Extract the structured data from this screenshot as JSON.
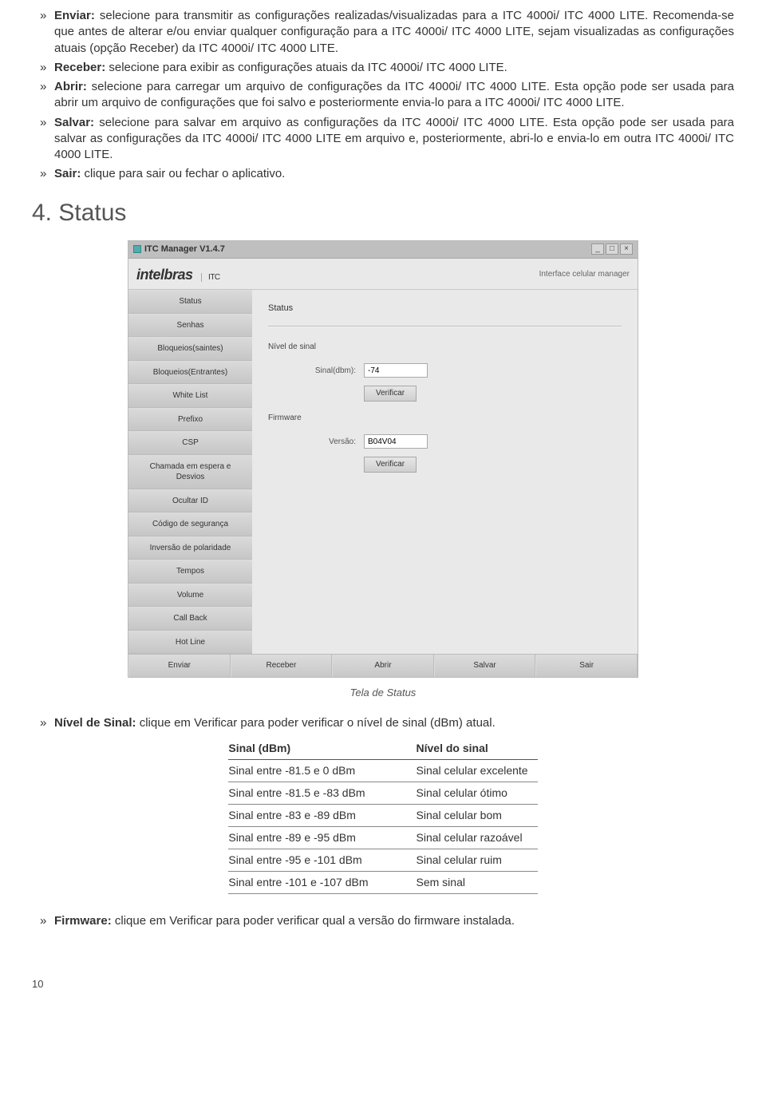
{
  "bullets_top": [
    {
      "term": "Enviar:",
      "text": " selecione para transmitir as configurações realizadas/visualizadas para a ITC 4000i/ ITC 4000 LITE. Recomenda-se que antes de alterar e/ou enviar qualquer configuração para a ITC 4000i/ ITC 4000 LITE, sejam visualizadas as configurações atuais (opção Receber) da ITC 4000i/ ITC 4000 LITE."
    },
    {
      "term": "Receber:",
      "text": " selecione para exibir as configurações atuais da ITC 4000i/ ITC 4000 LITE."
    },
    {
      "term": "Abrir:",
      "text": " selecione para carregar um arquivo de configurações da ITC 4000i/ ITC 4000 LITE. Esta opção pode ser usada para abrir um arquivo de configurações que foi salvo e posteriormente envia-lo para a ITC 4000i/ ITC 4000 LITE."
    },
    {
      "term": "Salvar:",
      "text": " selecione para salvar em arquivo as configurações da ITC 4000i/ ITC 4000 LITE. Esta opção pode ser usada para salvar as configurações da ITC 4000i/ ITC 4000 LITE em arquivo e, posteriormente, abri-lo e envia-lo em outra ITC 4000i/ ITC 4000 LITE."
    },
    {
      "term": "Sair:",
      "text": " clique para sair ou fechar o aplicativo."
    }
  ],
  "section_title": "4. Status",
  "app": {
    "window_title": "ITC Manager V1.4.7",
    "logo": "intelbras",
    "logo_sub": "ITC",
    "header_tag": "Interface celular manager",
    "sidebar": [
      "Status",
      "Senhas",
      "Bloqueios(saintes)",
      "Bloqueios(Entrantes)",
      "White List",
      "Prefixo",
      "CSP",
      "Chamada em espera e Desvios",
      "Ocultar ID",
      "Código de segurança",
      "Inversão de polaridade",
      "Tempos",
      "Volume",
      "Call Back",
      "Hot Line"
    ],
    "main": {
      "title": "Status",
      "grp1": "Nível de sinal",
      "row1_label": "Sinal(dbm):",
      "row1_value": "-74",
      "btn_verify": "Verificar",
      "grp2": "Firmware",
      "row2_label": "Versão:",
      "row2_value": "B04V04"
    },
    "footbar": [
      "Enviar",
      "Receber",
      "Abrir",
      "Salvar",
      "Sair"
    ]
  },
  "caption": "Tela de Status",
  "bullet_nivel": {
    "term": "Nível de Sinal:",
    "text": " clique em Verificar para poder verificar o nível de sinal (dBm) atual."
  },
  "sigtable": {
    "header": [
      "Sinal (dBm)",
      "Nível do sinal"
    ],
    "rows": [
      [
        "Sinal entre -81.5 e 0 dBm",
        "Sinal celular excelente"
      ],
      [
        "Sinal entre -81.5 e -83 dBm",
        "Sinal celular ótimo"
      ],
      [
        "Sinal entre -83 e -89 dBm",
        "Sinal celular bom"
      ],
      [
        "Sinal entre -89 e -95 dBm",
        "Sinal celular razoável"
      ],
      [
        "Sinal entre -95 e -101 dBm",
        "Sinal celular ruim"
      ],
      [
        "Sinal entre -101 e -107 dBm",
        "Sem sinal"
      ]
    ]
  },
  "bullet_firmware": {
    "term": "Firmware:",
    "text": " clique em Verificar para poder verificar qual a versão do firmware instalada."
  },
  "page_number": "10"
}
